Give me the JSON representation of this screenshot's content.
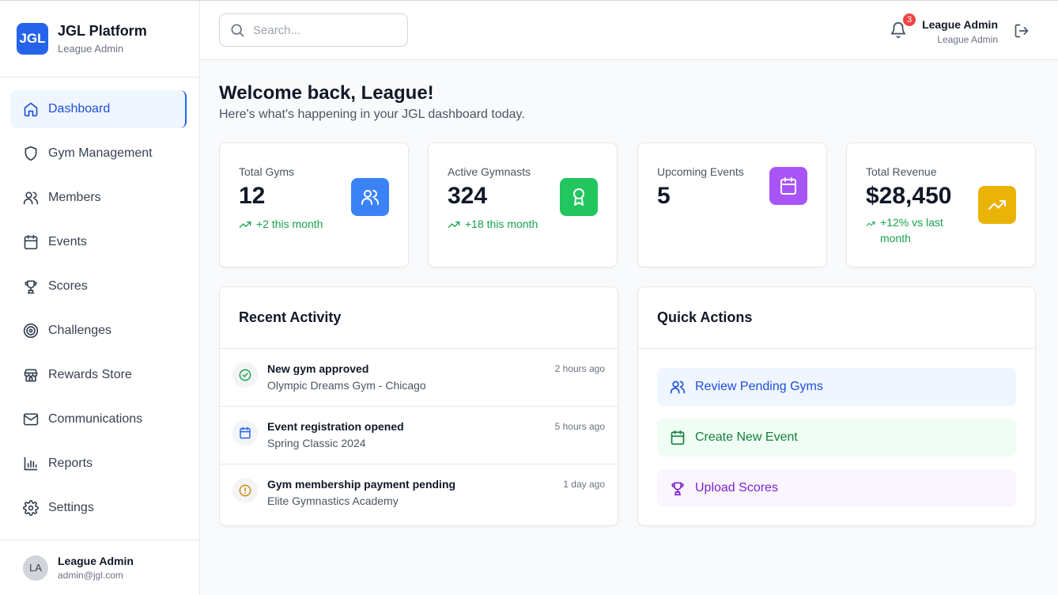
{
  "brand": {
    "logo": "JGL",
    "title": "JGL Platform",
    "subtitle": "League Admin"
  },
  "nav": [
    {
      "label": "Dashboard",
      "icon": "home-icon",
      "active": true
    },
    {
      "label": "Gym Management",
      "icon": "shield-icon"
    },
    {
      "label": "Members",
      "icon": "users-icon"
    },
    {
      "label": "Events",
      "icon": "calendar-icon"
    },
    {
      "label": "Scores",
      "icon": "trophy-icon"
    },
    {
      "label": "Challenges",
      "icon": "target-icon"
    },
    {
      "label": "Rewards Store",
      "icon": "store-icon"
    },
    {
      "label": "Communications",
      "icon": "mail-icon"
    },
    {
      "label": "Reports",
      "icon": "bar-chart-icon"
    },
    {
      "label": "Settings",
      "icon": "gear-icon"
    }
  ],
  "sidebar_user": {
    "initials": "LA",
    "name": "League Admin",
    "email": "admin@jgl.com"
  },
  "header": {
    "search_placeholder": "Search...",
    "notification_count": "3",
    "user_name": "League Admin",
    "user_role": "League Admin"
  },
  "welcome": {
    "title": "Welcome back, League!",
    "subtitle": "Here's what's happening in your JGL dashboard today."
  },
  "stats": [
    {
      "label": "Total Gyms",
      "value": "12",
      "trend": "+2 this month",
      "icon": "users-icon",
      "color": "#3b82f6"
    },
    {
      "label": "Active Gymnasts",
      "value": "324",
      "trend": "+18 this month",
      "icon": "award-icon",
      "color": "#22c55e"
    },
    {
      "label": "Upcoming Events",
      "value": "5",
      "trend": "",
      "icon": "calendar-icon",
      "color": "#a855f7"
    },
    {
      "label": "Total Revenue",
      "value": "$28,450",
      "trend": "+12% vs last month",
      "icon": "trending-up-icon",
      "color": "#eab308"
    }
  ],
  "recent_activity": {
    "title": "Recent Activity",
    "items": [
      {
        "title": "New gym approved",
        "subtitle": "Olympic Dreams Gym - Chicago",
        "time": "2 hours ago",
        "icon": "check-circle-icon",
        "color": "#16a34a"
      },
      {
        "title": "Event registration opened",
        "subtitle": "Spring Classic 2024",
        "time": "5 hours ago",
        "icon": "calendar-icon",
        "color": "#2563eb"
      },
      {
        "title": "Gym membership payment pending",
        "subtitle": "Elite Gymnastics Academy",
        "time": "1 day ago",
        "icon": "alert-circle-icon",
        "color": "#ca8a04"
      }
    ]
  },
  "quick_actions": {
    "title": "Quick Actions",
    "items": [
      {
        "label": "Review Pending Gyms",
        "icon": "users-icon"
      },
      {
        "label": "Create New Event",
        "icon": "calendar-icon"
      },
      {
        "label": "Upload Scores",
        "icon": "trophy-icon"
      }
    ]
  }
}
